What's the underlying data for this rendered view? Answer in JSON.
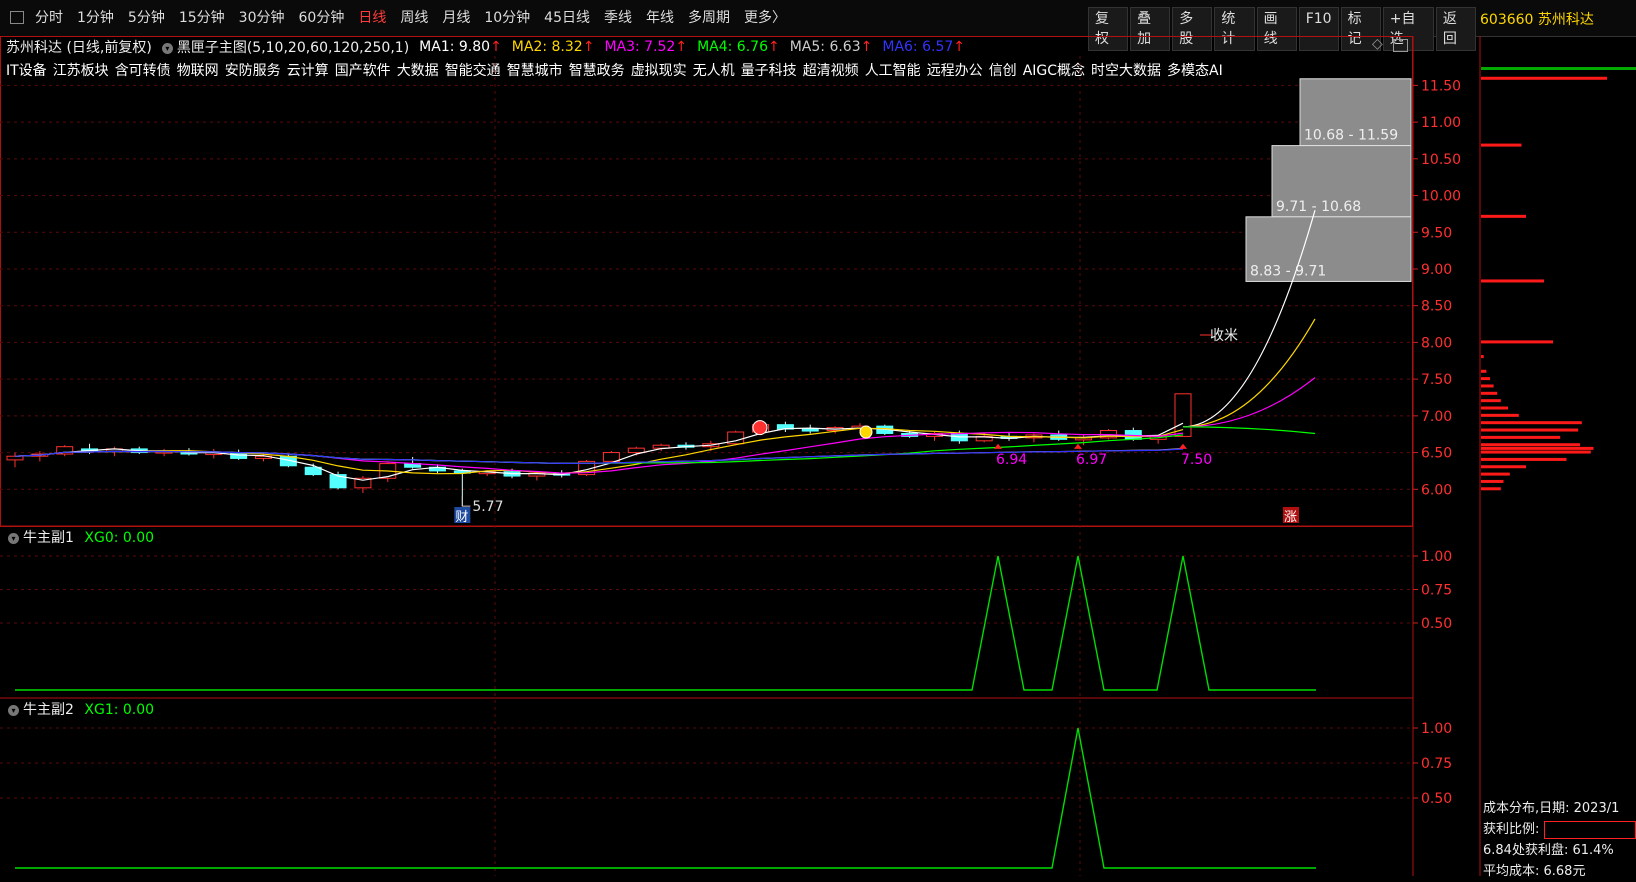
{
  "toolbar": {
    "periods": [
      "分时",
      "1分钟",
      "5分钟",
      "15分钟",
      "30分钟",
      "60分钟",
      "日线",
      "周线",
      "月线",
      "10分钟",
      "45日线",
      "季线",
      "年线",
      "多周期",
      "更多〉"
    ],
    "active_period": "日线",
    "buttons": [
      "复权",
      "叠加",
      "多股",
      "统计",
      "画线",
      "F10",
      "标记",
      "+自选",
      "返回"
    ]
  },
  "stock": {
    "code_name": "603660 苏州科达",
    "title": "苏州科达 (日线,前复权)"
  },
  "indicator": {
    "name": "黑匣子主图(5,10,20,60,120,250,1)",
    "ma": [
      {
        "label": "MA1: 9.80",
        "arrow": "↑",
        "color": "#ffffff"
      },
      {
        "label": "MA2: 8.32",
        "arrow": "↑",
        "color": "#ffd700"
      },
      {
        "label": "MA3: 7.52",
        "arrow": "↑",
        "color": "#ff00ff"
      },
      {
        "label": "MA4: 6.76",
        "arrow": "↑",
        "color": "#00ff00"
      },
      {
        "label": "MA5: 6.63",
        "arrow": "↑",
        "color": "#cccccc"
      },
      {
        "label": "MA6: 6.57",
        "arrow": "↑",
        "color": "#3333ff"
      }
    ]
  },
  "concepts": [
    "IT设备",
    "江苏板块",
    "含可转债",
    "物联网",
    "安防服务",
    "云计算",
    "国产软件",
    "大数据",
    "智能交通",
    "智慧城市",
    "智慧政务",
    "虚拟现实",
    "无人机",
    "量子科技",
    "超清视频",
    "人工智能",
    "远程办公",
    "信创",
    "AIGC概念",
    "时空大数据",
    "多模态AI"
  ],
  "main_chart": {
    "y_ticks": [
      "11.50",
      "11.00",
      "10.50",
      "10.00",
      "9.50",
      "9.00",
      "8.50",
      "8.00",
      "7.50",
      "7.00",
      "6.50",
      "6.00"
    ],
    "zones": [
      "10.68 - 11.59",
      "9.71 - 10.68",
      "8.83 - 9.71"
    ],
    "annotations": {
      "shoumi": "收米",
      "low": "5.77",
      "cai": "财",
      "zhang": "涨",
      "p1": "6.94",
      "p2": "6.97",
      "p3": "7.50"
    }
  },
  "sub1": {
    "name": "牛主副1",
    "value": "XG0: 0.00",
    "y_ticks": [
      "1.00",
      "0.75",
      "0.50"
    ]
  },
  "sub2": {
    "name": "牛主副2",
    "value": "XG1: 0.00",
    "y_ticks": [
      "1.00",
      "0.75",
      "0.50"
    ]
  },
  "cost": {
    "date_label": "成本分布,日期: 2023/1",
    "profit_label": "获利比例:",
    "profit_line": "6.84处获利盘: 61.4%",
    "avg_cost": "平均成本: 6.68元"
  },
  "chart_data": {
    "type": "candlestick",
    "price_range": [
      5.5,
      11.9
    ],
    "candles": [
      [
        6.4,
        6.5,
        6.3,
        6.45
      ],
      [
        6.45,
        6.52,
        6.38,
        6.48
      ],
      [
        6.48,
        6.6,
        6.45,
        6.58
      ],
      [
        6.55,
        6.62,
        6.48,
        6.52
      ],
      [
        6.52,
        6.58,
        6.45,
        6.55
      ],
      [
        6.55,
        6.58,
        6.48,
        6.5
      ],
      [
        6.5,
        6.55,
        6.45,
        6.52
      ],
      [
        6.52,
        6.56,
        6.46,
        6.48
      ],
      [
        6.48,
        6.55,
        6.42,
        6.5
      ],
      [
        6.5,
        6.54,
        6.4,
        6.42
      ],
      [
        6.42,
        6.5,
        6.38,
        6.45
      ],
      [
        6.45,
        6.48,
        6.3,
        6.32
      ],
      [
        6.3,
        6.35,
        6.18,
        6.2
      ],
      [
        6.2,
        6.24,
        6.0,
        6.02
      ],
      [
        6.02,
        6.18,
        5.95,
        6.15
      ],
      [
        6.15,
        6.38,
        6.1,
        6.35
      ],
      [
        6.35,
        6.44,
        6.28,
        6.3
      ],
      [
        6.3,
        6.34,
        6.22,
        6.25
      ],
      [
        6.25,
        6.28,
        5.77,
        6.22
      ],
      [
        6.22,
        6.26,
        6.18,
        6.24
      ],
      [
        6.24,
        6.28,
        6.15,
        6.18
      ],
      [
        6.18,
        6.24,
        6.12,
        6.22
      ],
      [
        6.22,
        6.26,
        6.16,
        6.2
      ],
      [
        6.2,
        6.4,
        6.18,
        6.38
      ],
      [
        6.38,
        6.52,
        6.35,
        6.5
      ],
      [
        6.5,
        6.58,
        6.46,
        6.56
      ],
      [
        6.56,
        6.62,
        6.52,
        6.6
      ],
      [
        6.6,
        6.64,
        6.54,
        6.58
      ],
      [
        6.58,
        6.66,
        6.52,
        6.62
      ],
      [
        6.62,
        6.8,
        6.6,
        6.78
      ],
      [
        6.78,
        6.9,
        6.74,
        6.88
      ],
      [
        6.88,
        6.92,
        6.78,
        6.82
      ],
      [
        6.82,
        6.88,
        6.76,
        6.8
      ],
      [
        6.8,
        6.86,
        6.76,
        6.84
      ],
      [
        6.84,
        6.9,
        6.8,
        6.86
      ],
      [
        6.86,
        6.88,
        6.74,
        6.76
      ],
      [
        6.76,
        6.8,
        6.7,
        6.72
      ],
      [
        6.72,
        6.78,
        6.66,
        6.76
      ],
      [
        6.76,
        6.8,
        6.62,
        6.66
      ],
      [
        6.66,
        6.76,
        6.64,
        6.72
      ],
      [
        6.72,
        6.78,
        6.66,
        6.7
      ],
      [
        6.7,
        6.76,
        6.64,
        6.74
      ],
      [
        6.74,
        6.8,
        6.66,
        6.68
      ],
      [
        6.68,
        6.74,
        6.6,
        6.7
      ],
      [
        6.7,
        6.82,
        6.68,
        6.8
      ],
      [
        6.8,
        6.84,
        6.66,
        6.68
      ],
      [
        6.68,
        6.74,
        6.62,
        6.72
      ],
      [
        6.72,
        7.3,
        6.72,
        7.3
      ]
    ],
    "histogram": [
      [
        6.0,
        22
      ],
      [
        6.1,
        25
      ],
      [
        6.2,
        32
      ],
      [
        6.3,
        50
      ],
      [
        6.4,
        95
      ],
      [
        6.5,
        122
      ],
      [
        6.55,
        125
      ],
      [
        6.6,
        110
      ],
      [
        6.7,
        88
      ],
      [
        6.8,
        108
      ],
      [
        6.9,
        112
      ],
      [
        7.0,
        42
      ],
      [
        7.1,
        30
      ],
      [
        7.2,
        22
      ],
      [
        7.3,
        18
      ],
      [
        7.4,
        14
      ],
      [
        7.5,
        10
      ],
      [
        7.6,
        6
      ],
      [
        7.8,
        3
      ],
      [
        8.0,
        80
      ],
      [
        8.83,
        70
      ],
      [
        9.71,
        50
      ],
      [
        10.68,
        45
      ],
      [
        11.59,
        140
      ]
    ]
  }
}
